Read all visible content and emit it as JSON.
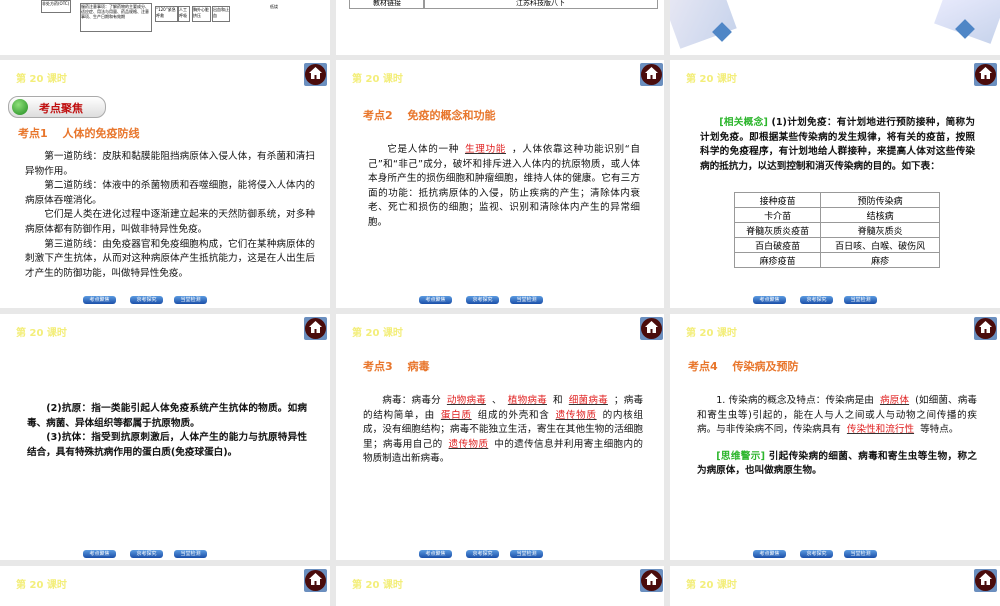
{
  "common": {
    "lesson": "第 20 课时",
    "nav": [
      "考点聚焦",
      "京考探究",
      "当堂检测"
    ]
  },
  "top": {
    "flow": {
      "box1": "非处方药(OTC)",
      "box2": "服药注意事项：了解药物的主要成分、适应症、用法与用量、药品规格、注意事项、生产日期和有效期",
      "box3": "“120”紧急呼救",
      "box4": "人工呼吸",
      "box5": "胸外心脏挤压",
      "box6": "出血和止血",
      "label": "低烧"
    },
    "table": {
      "left": "教材链接",
      "right": "江苏科技版八下"
    }
  },
  "s1": {
    "pill": "考点聚焦",
    "title": "考点1　 人体的免疫防线",
    "paras": [
      "第一道防线：皮肤和黏膜能阻挡病原体入侵人体，有杀菌和清扫异物作用。",
      "第二道防线：体液中的杀菌物质和吞噬细胞，能将侵入人体内的病原体吞噬消化。",
      "它们是人类在进化过程中逐渐建立起来的天然防御系统，对多种病原体都有防御作用，叫做非特异性免疫。",
      "第三道防线：由免疫器官和免疫细胞构成，它们在某种病原体的刺激下产生抗体，从而对这种病原体产生抵抗能力，这是在人出生后才产生的防御功能，叫做特异性免疫。"
    ]
  },
  "s2": {
    "title": "考点2　 免疫的概念和功能",
    "pre": "它是人体的一种",
    "blank": "生理功能",
    "post": "，人体依靠这种功能识别“自己”和“非己”成分，破坏和排斥进入人体内的抗原物质，或人体本身所产生的损伤细胞和肿瘤细胞，维持人体的健康。它有三方面的功能：抵抗病原体的入侵，防止疾病的产生；清除体内衰老、死亡和损伤的细胞；监视、识别和清除体内产生的异常细胞。"
  },
  "s3": {
    "tag": "[相关概念]",
    "text": " (1)计划免疫：有计划地进行预防接种，简称为计划免疫。即根据某些传染病的发生规律，将有关的疫苗，按照科学的免疫程序，有计划地给人群接种，来提高人体对这些传染病的抵抗力，以达到控制和消灭传染病的目的。如下表：",
    "table": [
      [
        "接种疫苗",
        "预防传染病"
      ],
      [
        "卡介苗",
        "结核病"
      ],
      [
        "脊髓灰质炎疫苗",
        "脊髓灰质炎"
      ],
      [
        "百白破疫苗",
        "百日咳、白喉、破伤风"
      ],
      [
        "麻疹疫苗",
        "麻疹"
      ]
    ]
  },
  "s4": {
    "paras": [
      "(2)抗原：指一类能引起人体免疫系统产生抗体的物质。如病毒、病菌、异体组织等都属于抗原物质。",
      "(3)抗体：指受到抗原刺激后，人体产生的能力与抗原特异性结合，具有特殊抗病作用的蛋白质(免疫球蛋白)。"
    ]
  },
  "s5": {
    "title": "考点3　 病毒",
    "t1": "病毒：病毒分",
    "b1": "动物病毒",
    "t2": "、",
    "b2": "植物病毒",
    "t3": "和",
    "b3": "细菌病毒",
    "t4": "；病毒的结构简单，由",
    "b4": "蛋白质",
    "t5": "组成的外壳和含",
    "b5": "遗传物质",
    "t6": "的内核组成，没有细胞结构；病毒不能独立生活，寄生在其他生物的活细胞里；病毒用自己的",
    "b6": "遗传物质",
    "t7": "中的遗传信息并利用寄主细胞内的物质制造出新病毒。"
  },
  "s6": {
    "title": "考点4　 传染病及预防",
    "t1": "1. 传染病的概念及特点：传染病是由",
    "b1": "病原体",
    "t2": "(如细菌、病毒和寄生虫等)引起的，能在人与人之间或人与动物之间传播的疾病。与非传染病不同，传染病具有",
    "b2": "传染性和流行性",
    "t3": "等特点。",
    "tag": "[思维警示]",
    "warn": " 引起传染病的细菌、病毒和寄生虫等生物，称之为病原体，也叫做病原生物。"
  }
}
